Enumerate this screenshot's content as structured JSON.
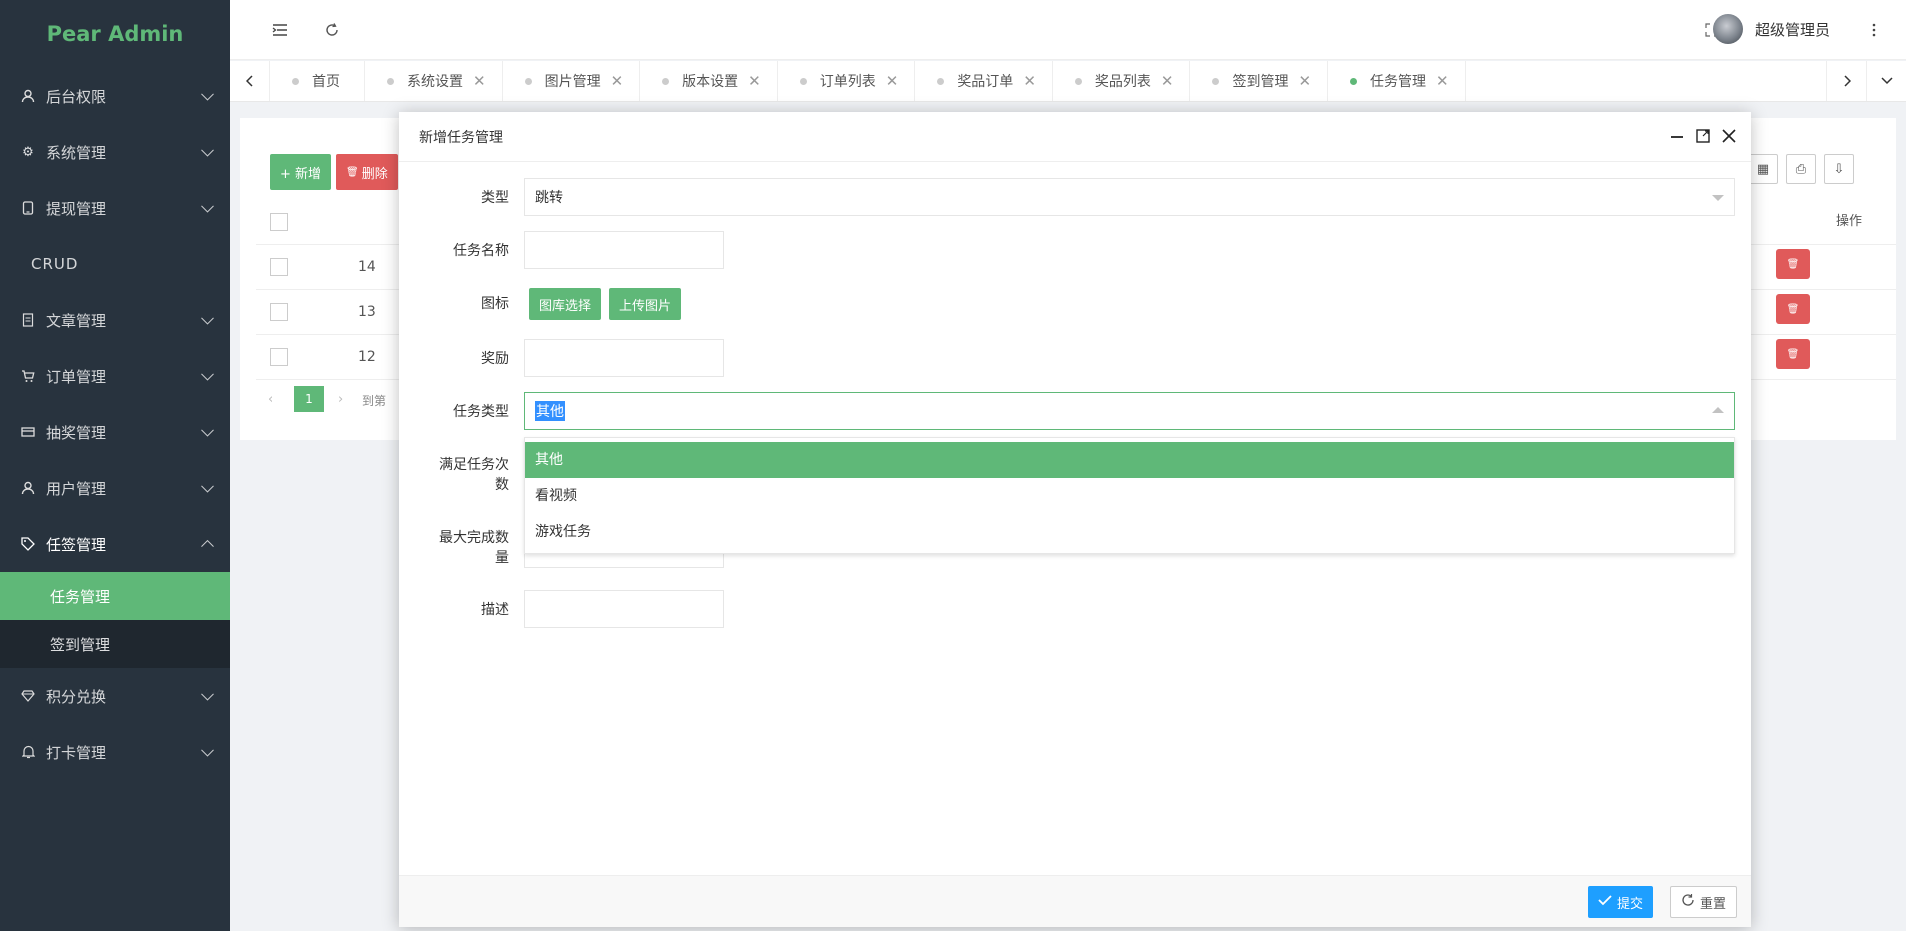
{
  "sidebar": {
    "logo": "Pear Admin",
    "items": [
      {
        "label": "后台权限",
        "icon": "user-icon"
      },
      {
        "label": "系统管理",
        "icon": "gear-icon"
      },
      {
        "label": "提现管理",
        "icon": "phone-icon"
      },
      {
        "label": "CRUD",
        "icon": ""
      },
      {
        "label": "文章管理",
        "icon": "document-icon"
      },
      {
        "label": "订单管理",
        "icon": "cart-icon"
      },
      {
        "label": "抽奖管理",
        "icon": "card-icon"
      },
      {
        "label": "用户管理",
        "icon": "user-icon"
      },
      {
        "label": "任签管理",
        "icon": "tag-icon"
      },
      {
        "label": "积分兑换",
        "icon": "diamond-icon"
      },
      {
        "label": "打卡管理",
        "icon": "bell-icon"
      }
    ],
    "subitems": [
      {
        "label": "任务管理",
        "active": true
      },
      {
        "label": "签到管理",
        "active": false
      }
    ],
    "colors": {
      "bg": "#28333e",
      "accent": "#5fb878"
    }
  },
  "header": {
    "username": "超级管理员"
  },
  "tabs": [
    {
      "label": "首页",
      "closable": false,
      "active": false
    },
    {
      "label": "系统设置",
      "closable": true,
      "active": false
    },
    {
      "label": "图片管理",
      "closable": true,
      "active": false
    },
    {
      "label": "版本设置",
      "closable": true,
      "active": false
    },
    {
      "label": "订单列表",
      "closable": true,
      "active": false
    },
    {
      "label": "奖品订单",
      "closable": true,
      "active": false
    },
    {
      "label": "奖品列表",
      "closable": true,
      "active": false
    },
    {
      "label": "签到管理",
      "closable": true,
      "active": false
    },
    {
      "label": "任务管理",
      "closable": true,
      "active": true
    }
  ],
  "background": {
    "add_label": "+ 新增",
    "delete_label": "删除",
    "ops_header": "操作",
    "rows": [
      "14",
      "13",
      "12"
    ],
    "page": "1",
    "goto_label": "到第"
  },
  "modal": {
    "title": "新增任务管理",
    "fields": {
      "type_label": "类型",
      "type_value": "跳转",
      "name_label": "任务名称",
      "icon_label": "图标",
      "gallery_btn": "图库选择",
      "upload_btn": "上传图片",
      "reward_label": "奖励",
      "task_type_label": "任务类型",
      "task_type_value": "其他",
      "times_label_1": "满足任务次",
      "times_label_2": "数",
      "max_label_1": "最大完成数",
      "max_label_2": "量",
      "desc_label": "描述"
    },
    "dropdown_options": [
      "其他",
      "看视频",
      "游戏任务"
    ],
    "submit_label": "提交",
    "reset_label": "重置",
    "colors": {
      "submit": "#1e9fff",
      "green": "#5fb878"
    }
  }
}
